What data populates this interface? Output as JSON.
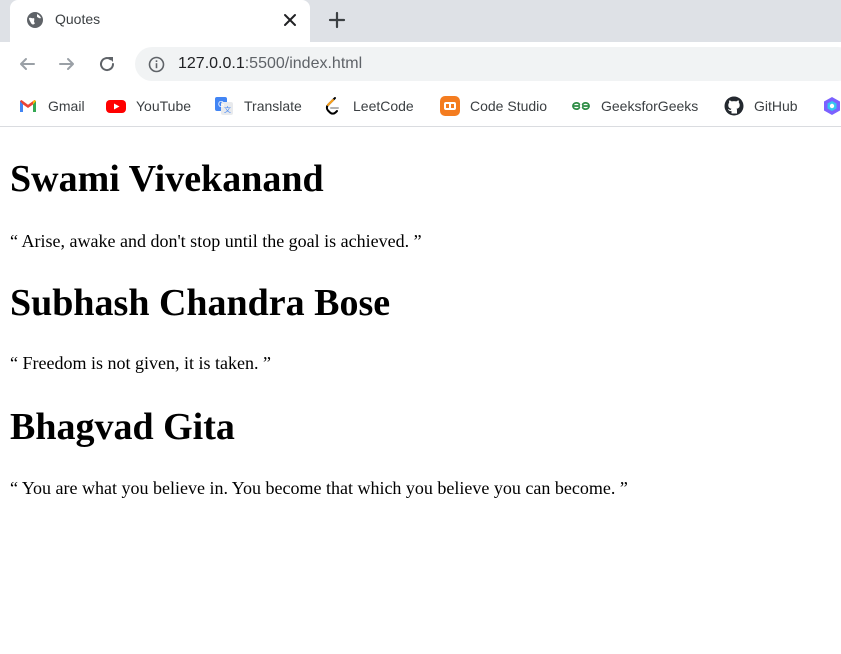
{
  "browser": {
    "tab": {
      "title": "Quotes"
    },
    "address": {
      "host": "127.0.0.1",
      "rest": ":5500/index.html"
    },
    "bookmarks": [
      {
        "label": "Gmail",
        "icon": "gmail-icon"
      },
      {
        "label": "YouTube",
        "icon": "youtube-icon"
      },
      {
        "label": "Translate",
        "icon": "translate-icon"
      },
      {
        "label": "LeetCode",
        "icon": "leetcode-icon"
      },
      {
        "label": "Code Studio",
        "icon": "code-studio-icon"
      },
      {
        "label": "GeeksforGeeks",
        "icon": "geeksforgeeks-icon"
      },
      {
        "label": "GitHub",
        "icon": "github-icon"
      }
    ]
  },
  "quotes": [
    {
      "author": "Swami Vivekanand",
      "text": "“ Arise, awake and don't stop until the goal is achieved. ”"
    },
    {
      "author": "Subhash Chandra Bose",
      "text": "“ Freedom is not given, it is taken. ”"
    },
    {
      "author": "Bhagvad Gita",
      "text": "“ You are what you believe in. You become that which you believe you can become. ”"
    }
  ],
  "colors": {
    "tabstrip": "#dee1e6",
    "omnibox": "#f1f3f4",
    "youtube": "#ff0000",
    "geeksforgeeks": "#2f8d46",
    "code_studio": "#f47c20"
  }
}
